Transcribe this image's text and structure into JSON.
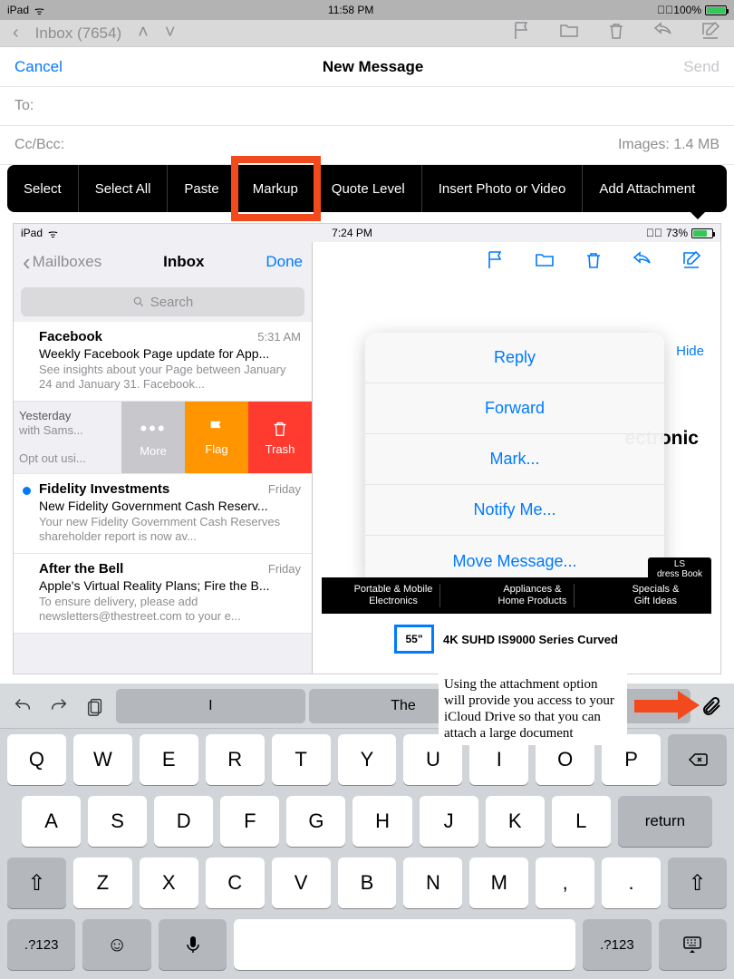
{
  "outer": {
    "status": {
      "device": "iPad",
      "time": "11:58 PM",
      "battery_pct": "100%"
    },
    "peek": {
      "inbox_label": "Inbox (7654)"
    },
    "nav": {
      "cancel": "Cancel",
      "title": "New Message",
      "send": "Send"
    },
    "to": "To:",
    "ccbcc": "Cc/Bcc:",
    "images_size": "Images: 1.4 MB"
  },
  "editbar": {
    "select": "Select",
    "select_all": "Select All",
    "paste": "Paste",
    "markup": "Markup",
    "quote_level": "Quote Level",
    "insert_photo": "Insert Photo or Video",
    "add_attachment": "Add Attachment"
  },
  "inner": {
    "status": {
      "device": "iPad",
      "time": "7:24 PM",
      "battery_pct": "73%"
    },
    "inbox_nav": {
      "mailboxes": "Mailboxes",
      "title": "Inbox",
      "done": "Done"
    },
    "search_placeholder": "Search",
    "messages": [
      {
        "name": "Facebook",
        "time": "5:31 AM",
        "subj": "Weekly Facebook Page update for App...",
        "prev": "See insights about your Page between January 24 and January 31. Facebook..."
      },
      {
        "swipe": true,
        "day": "Yesterday",
        "line1": "with Sams...",
        "line2": "Opt out usi..."
      },
      {
        "unread": true,
        "name": "Fidelity Investments",
        "time": "Friday",
        "subj": "New Fidelity Government Cash Reserv...",
        "prev": "Your new Fidelity Government Cash Reserves shareholder report is now av..."
      },
      {
        "name": "After the Bell",
        "time": "Friday",
        "subj": "Apple's Virtual Reality Plans; Fire the B...",
        "prev": "To ensure delivery, please add newsletters@thestreet.com to your e..."
      }
    ],
    "swipe": {
      "more": "More",
      "flag": "Flag",
      "trash": "Trash"
    },
    "detail": {
      "hide": "Hide",
      "electronic_fragment": "ectronic",
      "actions": [
        "Reply",
        "Forward",
        "Mark...",
        "Notify Me...",
        "Move Message..."
      ],
      "promo_cap": "LS\ndress Book",
      "promo": [
        "Portable & Mobile\nElectronics",
        "Appliances &\nHome Products",
        "Specials &\nGift Ideas"
      ],
      "tv": {
        "size": "55\"",
        "label": "4K SUHD IS9000 Series Curved"
      }
    }
  },
  "keyboard": {
    "predictions": [
      "I",
      "The",
      ""
    ],
    "row1": [
      "Q",
      "W",
      "E",
      "R",
      "T",
      "Y",
      "U",
      "I",
      "O",
      "P"
    ],
    "row2": [
      "A",
      "S",
      "D",
      "F",
      "G",
      "H",
      "J",
      "K",
      "L"
    ],
    "return": "return",
    "row3": [
      "Z",
      "X",
      "C",
      "V",
      "B",
      "N",
      "M",
      ",",
      "."
    ],
    "numkey": ".?123"
  },
  "note": "Using the attachment option will provide you access to your iCloud Drive so that you can attach a large document"
}
